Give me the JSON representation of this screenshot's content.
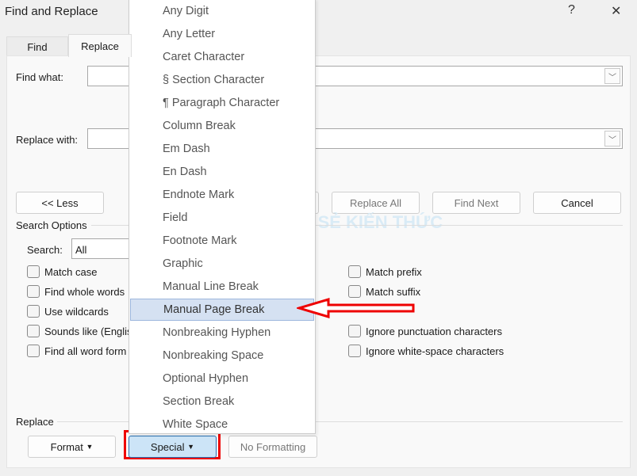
{
  "window": {
    "title": "Find and Replace",
    "help": "?",
    "close": "✕"
  },
  "tabs": [
    {
      "label": "Find",
      "active": false
    },
    {
      "label": "Replace",
      "active": true
    }
  ],
  "find_what": {
    "label": "Find what:",
    "value": ""
  },
  "replace_with": {
    "label": "Replace with:",
    "value": ""
  },
  "buttons": {
    "less": "<< Less",
    "replace_all": "Replace All",
    "find_next": "Find Next",
    "cancel": "Cancel"
  },
  "search_options": {
    "title": "Search Options",
    "search_label": "Search:",
    "search_value": "All",
    "left": [
      {
        "label": "Match case",
        "checked": false
      },
      {
        "label": "Find whole words",
        "checked": false
      },
      {
        "label": "Use wildcards",
        "checked": false
      },
      {
        "label": "Sounds like (Englis",
        "checked": false
      },
      {
        "label": "Find all word form",
        "checked": false
      }
    ],
    "right": [
      {
        "label": "Match prefix",
        "checked": false
      },
      {
        "label": "Match suffix",
        "checked": false
      },
      {
        "label": "Ignore punctuation characters",
        "checked": false
      },
      {
        "label": "Ignore white-space characters",
        "checked": false
      }
    ]
  },
  "replace_group": {
    "title": "Replace",
    "format": "Format",
    "special": "Special",
    "no_formatting": "No Formatting"
  },
  "special_menu": {
    "items": [
      "Any Digit",
      "Any Letter",
      "Caret Character",
      "§ Section Character",
      "¶ Paragraph Character",
      "Column Break",
      "Em Dash",
      "En Dash",
      "Endnote Mark",
      "Field",
      "Footnote Mark",
      "Graphic",
      "Manual Line Break",
      "Manual Page Break",
      "Nonbreaking Hyphen",
      "Nonbreaking Space",
      "Optional Hyphen",
      "Section Break",
      "White Space"
    ],
    "highlighted": "Manual Page Break"
  },
  "watermark": "CHIA SẺ KIẾN THỨC",
  "colors": {
    "annotation": "#ff0000",
    "highlight": "#d5e1f2",
    "special_button": "#cce4f7"
  }
}
